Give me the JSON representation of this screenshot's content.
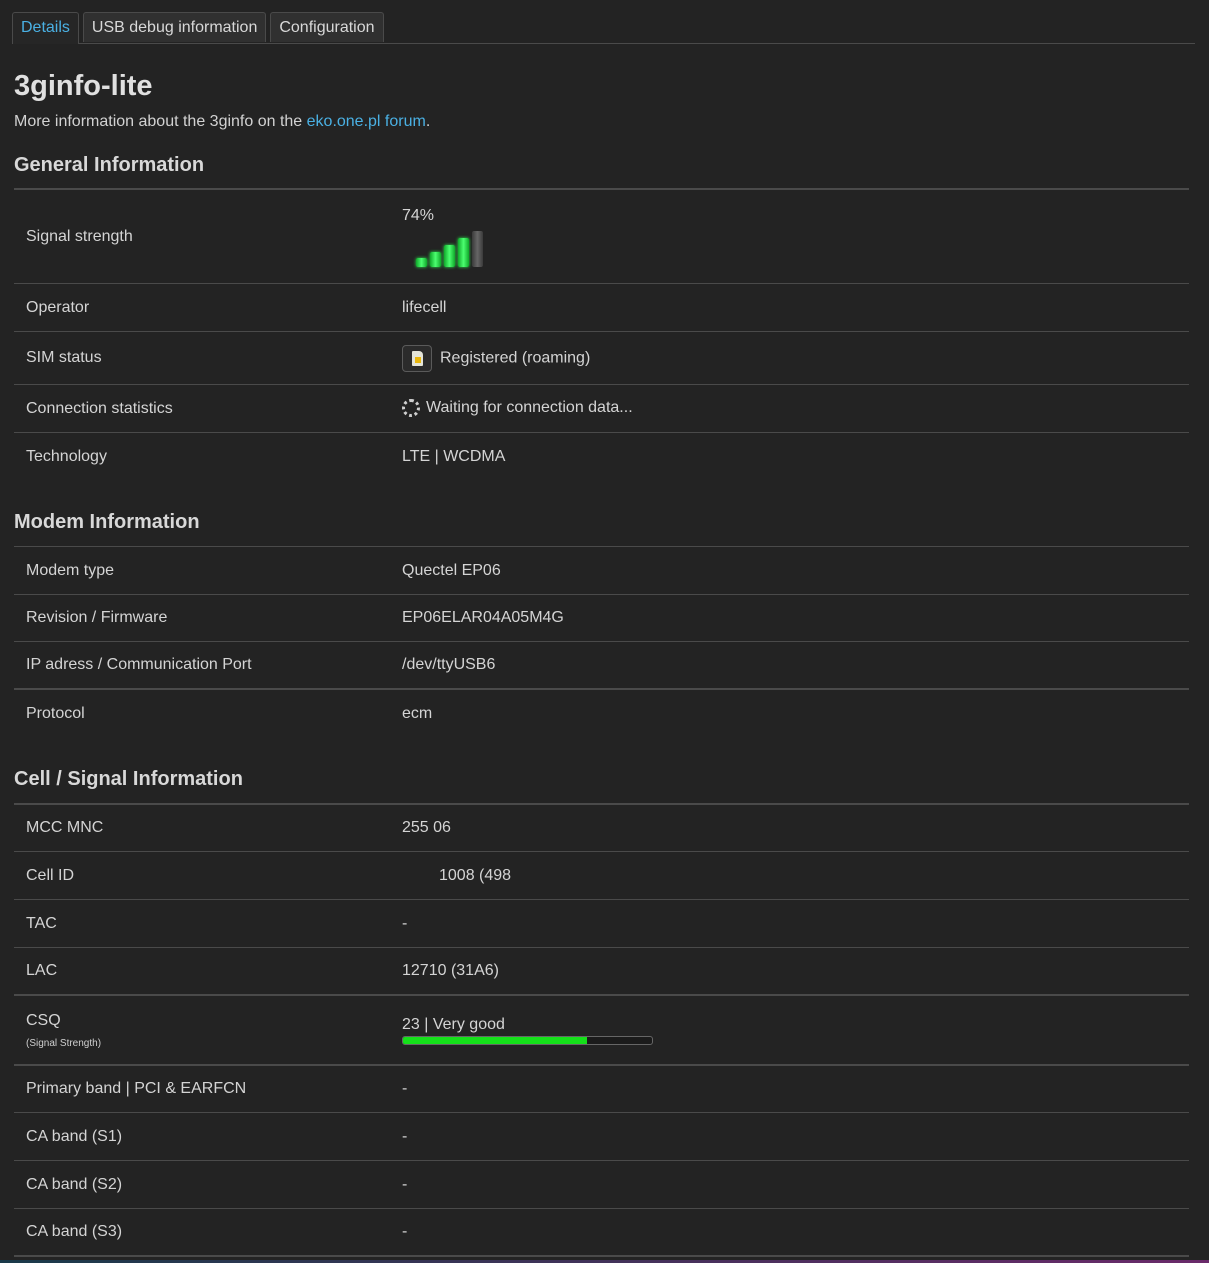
{
  "tabs": [
    {
      "label": "Details",
      "active": true
    },
    {
      "label": "USB debug information",
      "active": false
    },
    {
      "label": "Configuration",
      "active": false
    }
  ],
  "header": {
    "title": "3ginfo-lite",
    "subtitle_prefix": "More information about the 3ginfo on the ",
    "subtitle_link": "eko.one.pl forum",
    "subtitle_suffix": "."
  },
  "general": {
    "title": "General Information",
    "signal_label": "Signal strength",
    "signal_value": "74%",
    "signal_bars_filled": 4,
    "signal_bars_total": 5,
    "operator_label": "Operator",
    "operator_value": "lifecell",
    "sim_label": "SIM status",
    "sim_value": "Registered (roaming)",
    "conn_label": "Connection statistics",
    "conn_value": "Waiting for connection data...",
    "tech_label": "Technology",
    "tech_value": "LTE | WCDMA"
  },
  "modem": {
    "title": "Modem Information",
    "type_label": "Modem type",
    "type_value": "Quectel EP06",
    "rev_label": "Revision / Firmware",
    "rev_value": "EP06ELAR04A05M4G",
    "ip_label": "IP adress / Communication Port",
    "ip_value": "/dev/ttyUSB6",
    "proto_label": "Protocol",
    "proto_value": "ecm"
  },
  "cell": {
    "title": "Cell / Signal Information",
    "mcc_label": "MCC MNC",
    "mcc_value": "255 06",
    "cellid_label": "Cell ID",
    "cellid_value": "1008 (498",
    "tac_label": "TAC",
    "tac_value": "-",
    "lac_label": "LAC",
    "lac_value": "12710 (31A6)",
    "csq_label": "CSQ",
    "csq_sublabel": "(Signal Strength)",
    "csq_value": "23 | Very good",
    "csq_fraction": 0.74,
    "band_label": "Primary band | PCI & EARFCN",
    "band_value": "-",
    "ca1_label": "CA band (S1)",
    "ca1_value": "-",
    "ca2_label": "CA band (S2)",
    "ca2_value": "-",
    "ca3_label": "CA band (S3)",
    "ca3_value": "-"
  },
  "colors": {
    "background": "#232323",
    "accent": "#4ab0e3",
    "signal_green": "#15e01a"
  }
}
